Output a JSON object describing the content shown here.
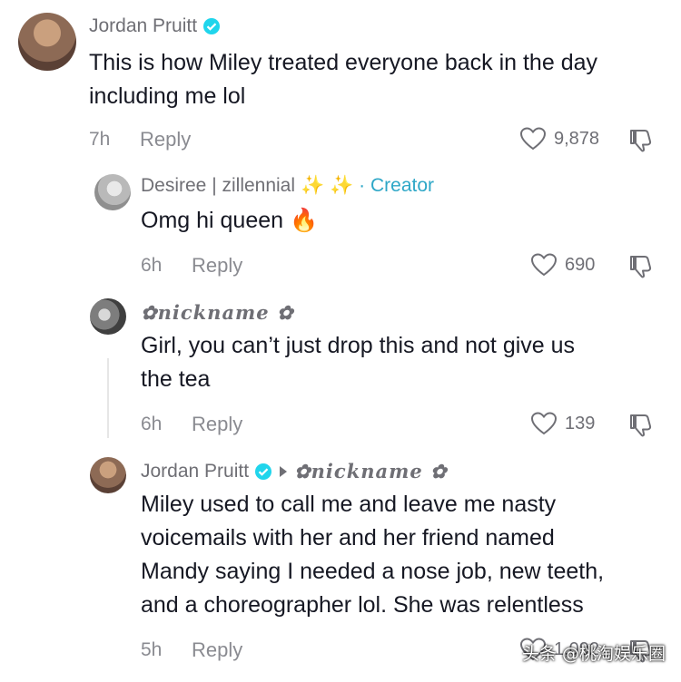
{
  "comments": [
    {
      "username": "Jordan Pruitt",
      "verified": true,
      "text_lines": [
        "This is how Miley treated everyone back in the day",
        "including me lol"
      ],
      "time": "7h",
      "reply_label": "Reply",
      "likes": "9,878"
    },
    {
      "username": "Desiree | zillennial",
      "username_suffix": "✨ ✨",
      "creator_label": "· Creator",
      "text": "Omg hi queen",
      "text_emoji": "🔥",
      "time": "6h",
      "reply_label": "Reply",
      "likes": "690"
    },
    {
      "username": "✿𝒏𝒊𝒄𝒌𝒏𝒂𝒎𝒆 ✿",
      "text_lines": [
        "Girl, you can’t just drop this and not give us",
        "the tea"
      ],
      "time": "6h",
      "reply_label": "Reply",
      "likes": "139"
    },
    {
      "username": "Jordan Pruitt",
      "verified": true,
      "reply_to": "✿𝒏𝒊𝒄𝒌𝒏𝒂𝒎𝒆 ✿",
      "text_lines": [
        "Miley used to call me and leave me nasty",
        "voicemails with her and her friend named",
        "Mandy saying I needed a nose job, new teeth,",
        "and a choreographer lol. She was relentless"
      ],
      "time": "5h",
      "reply_label": "Reply",
      "likes": "1,092"
    }
  ],
  "watermark": "头条 @桃淘娱乐圈",
  "colors": {
    "verified": "#20d5ec",
    "creator": "#2ea7c7",
    "muted": "#8a8b91"
  }
}
